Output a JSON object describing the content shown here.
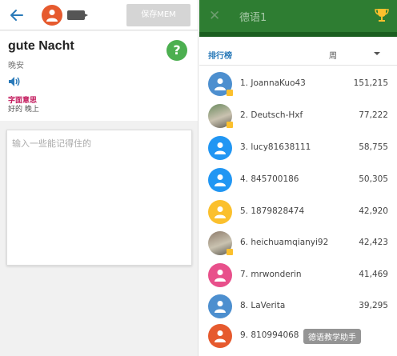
{
  "left": {
    "save_label": "保存MEM",
    "word": "gute Nacht",
    "meaning": "晚安",
    "help_label": "?",
    "literal_label": "字面意思",
    "literal_value": "好的 晚上",
    "mem_placeholder": "输入一些能记得住的"
  },
  "right": {
    "course_title": "德语1",
    "close_label": "✕",
    "leaderboard_label": "排行榜",
    "period_label": "周",
    "rows": [
      {
        "rank_name": "1. JoannaKuo43",
        "score": "151,215",
        "avatar_color": "#4d8fcf",
        "photo": false,
        "badge": true
      },
      {
        "rank_name": "2. Deutsch-Hxf",
        "score": "77,222",
        "avatar_color": "#6b8a5e",
        "photo": true,
        "badge": true
      },
      {
        "rank_name": "3. lucy81638111",
        "score": "58,755",
        "avatar_color": "#2196f3",
        "photo": false,
        "badge": false
      },
      {
        "rank_name": "4. 845700186",
        "score": "50,305",
        "avatar_color": "#2196f3",
        "photo": false,
        "badge": false
      },
      {
        "rank_name": "5. 1879828474",
        "score": "42,920",
        "avatar_color": "#fbc02d",
        "photo": false,
        "badge": false
      },
      {
        "rank_name": "6. heichuamqianyi92",
        "score": "42,423",
        "avatar_color": "#8d7b6a",
        "photo": true,
        "badge": true
      },
      {
        "rank_name": "7. mrwonderin",
        "score": "41,469",
        "avatar_color": "#e8508b",
        "photo": false,
        "badge": false
      },
      {
        "rank_name": "8. LaVerita",
        "score": "39,295",
        "avatar_color": "#4d8fcf",
        "photo": false,
        "badge": false
      },
      {
        "rank_name": "9. 810994068",
        "score": "",
        "avatar_color": "#e65a2e",
        "photo": false,
        "badge": false
      }
    ],
    "watermark": "德语教学助手"
  }
}
